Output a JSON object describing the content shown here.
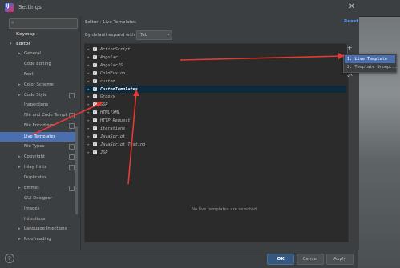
{
  "window": {
    "title": "Settings"
  },
  "sidebar": {
    "search_placeholder": "",
    "items": [
      {
        "label": "Keymap",
        "bold": true
      },
      {
        "label": "Editor",
        "bold": true,
        "expanded": true
      },
      {
        "label": "General",
        "collapsed": true
      },
      {
        "label": "Code Editing"
      },
      {
        "label": "Font"
      },
      {
        "label": "Color Scheme",
        "collapsed": true
      },
      {
        "label": "Code Style",
        "collapsed": true
      },
      {
        "label": "Inspections"
      },
      {
        "label": "File and Code Templ"
      },
      {
        "label": "File Encodings"
      },
      {
        "label": "Live Templates",
        "selected": true
      },
      {
        "label": "File Types"
      },
      {
        "label": "Copyright",
        "collapsed": true
      },
      {
        "label": "Inlay Hints",
        "collapsed": true
      },
      {
        "label": "Duplicates"
      },
      {
        "label": "Emmet",
        "collapsed": true
      },
      {
        "label": "GUI Designer"
      },
      {
        "label": "Images"
      },
      {
        "label": "Intentions"
      },
      {
        "label": "Language Injections",
        "collapsed": true
      },
      {
        "label": "Proofreading",
        "collapsed": true
      }
    ]
  },
  "content": {
    "breadcrumb": "Editor  ›  Live Templates",
    "reset": "Reset",
    "expand_label": "By default expand with",
    "expand_value": "Tab",
    "templates": [
      {
        "label": "ActionScript"
      },
      {
        "label": "Angular"
      },
      {
        "label": "AngularJS"
      },
      {
        "label": "ColdFusion"
      },
      {
        "label": "custom"
      },
      {
        "label": "CustomTemplates",
        "selected": true
      },
      {
        "label": "Groovy"
      },
      {
        "label": "GSP"
      },
      {
        "label": "HTML/XML"
      },
      {
        "label": "HTTP Request"
      },
      {
        "label": "iterations"
      },
      {
        "label": "JavaScript"
      },
      {
        "label": "JavaScript Testing"
      },
      {
        "label": "JSP"
      }
    ],
    "empty_message": "No live templates are selected",
    "side_tools": {
      "add": "+",
      "undo": "↶"
    }
  },
  "popup": {
    "items": [
      {
        "label": "1. Live Template",
        "highlighted": true
      },
      {
        "label": "2. Template Group..."
      }
    ]
  },
  "buttons": {
    "help": "?",
    "ok": "OK",
    "cancel": "Cancel",
    "apply": "Apply"
  },
  "colors": {
    "accent": "#4b6eaf",
    "link": "#589df6",
    "annotation_arrow": "#e53935",
    "background": "#3c3f41",
    "panel": "#2b2b2b"
  }
}
